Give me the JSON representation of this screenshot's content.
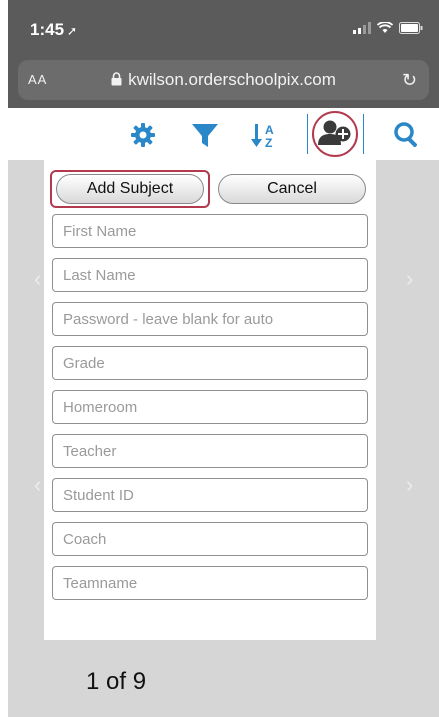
{
  "status": {
    "time": "1:45"
  },
  "browser": {
    "text_size_label": "AA",
    "domain": "kwilson.orderschoolpix.com"
  },
  "toolbar": {
    "icons": [
      "gear-icon",
      "filter-icon",
      "sort-az-icon",
      "add-user-icon",
      "search-icon"
    ],
    "accent": "#2a87c8",
    "highlight": "#b23a4e"
  },
  "form": {
    "add_label": "Add Subject",
    "cancel_label": "Cancel",
    "fields": [
      {
        "placeholder": "First Name"
      },
      {
        "placeholder": "Last Name"
      },
      {
        "placeholder": "Password - leave blank for auto"
      },
      {
        "placeholder": "Grade"
      },
      {
        "placeholder": "Homeroom"
      },
      {
        "placeholder": "Teacher"
      },
      {
        "placeholder": "Student ID"
      },
      {
        "placeholder": "Coach"
      },
      {
        "placeholder": "Teamname"
      }
    ]
  },
  "pager": {
    "label": "1 of 9"
  }
}
